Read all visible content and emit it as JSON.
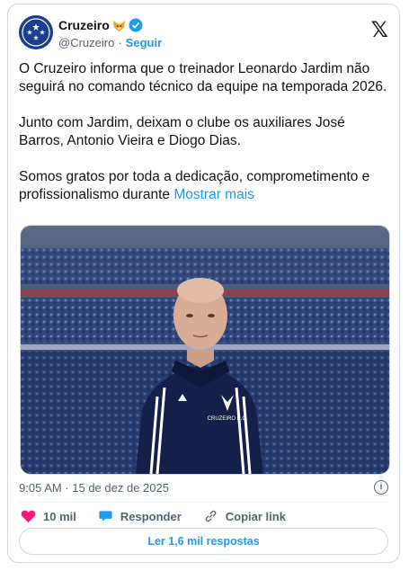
{
  "account": {
    "name": "Cruzeiro",
    "handle": "@Cruzeiro",
    "separator": "·",
    "follow_label": "Seguir"
  },
  "post": {
    "paragraphs": [
      "O Cruzeiro informa que o treinador Leonardo Jardim não seguirá no comando técnico da equipe na temporada 2026.",
      "Junto com Jardim, deixam o clube os auxiliares José Barros, Antonio Vieira e Diogo Dias."
    ],
    "last_paragraph": "Somos gratos por toda a dedicação, comprometimento e profissionalismo durante",
    "show_more": "Mostrar mais"
  },
  "media": {
    "jacket_brand": "CRUZEIRO E.C."
  },
  "meta": {
    "timestamp": "9:05 AM · 15 de dez de 2025"
  },
  "actions": {
    "likes": "10 mil",
    "reply_label": "Responder",
    "copy_label": "Copiar link"
  },
  "replies_button": "Ler 1,6 mil respostas",
  "icons": [
    "cruzeiro-logo-icon",
    "fox-emoji-icon",
    "verified-icon",
    "x-logo-icon",
    "info-icon",
    "heart-icon",
    "reply-icon",
    "link-icon"
  ],
  "colors": {
    "accent": "#1d9bf0",
    "like": "#f91880",
    "muted": "#536471"
  }
}
